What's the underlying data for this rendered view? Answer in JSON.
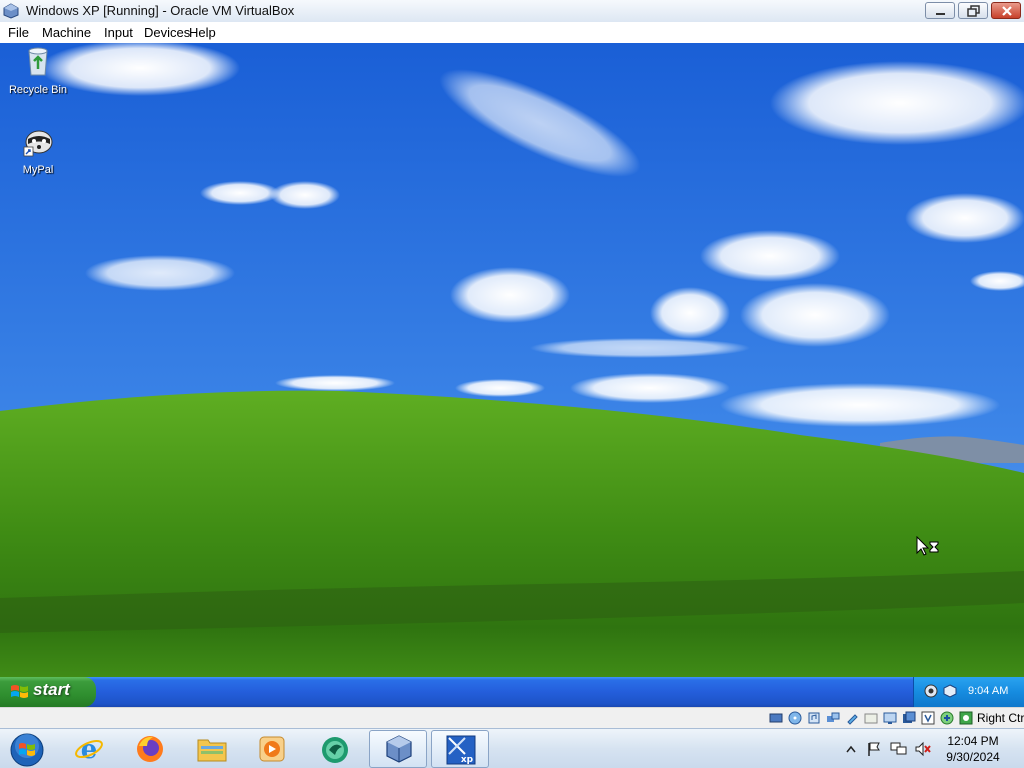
{
  "window": {
    "title": "Windows XP [Running] - Oracle VM VirtualBox",
    "icon": "virtualbox-icon",
    "controls": [
      "minimize-icon",
      "restore-icon",
      "close-icon"
    ]
  },
  "menubar": {
    "items": [
      "File",
      "Machine",
      "Input",
      "Devices",
      "Help"
    ]
  },
  "guest": {
    "desktop_icons": [
      {
        "label": "Recycle Bin",
        "icon": "recycle-bin-icon"
      },
      {
        "label": "MyPal",
        "icon": "mypal-icon"
      }
    ],
    "cursor": "busy-arrow-cursor",
    "taskbar": {
      "start_label": "start",
      "tray_icons": [
        "network-icon",
        "vbox-guest-additions-icon"
      ],
      "clock": "9:04 AM"
    }
  },
  "vbox_status": {
    "icons": [
      "hard-disk-icon",
      "optical-drive-icon",
      "audio-icon",
      "network-adapter-icon",
      "usb-icon",
      "shared-folders-icon",
      "display-icon",
      "video-capture-icon",
      "recording-icon",
      "virtualization-icon",
      "cpu-icon",
      "mouse-integration-icon",
      "keyboard-icon"
    ],
    "host_key": "Right Ctrl"
  },
  "host_taskbar": {
    "pinned": [
      "windows-start-orb-icon",
      "internet-explorer-icon",
      "firefox-icon",
      "file-explorer-icon",
      "media-player-icon",
      "app-icon",
      "virtualbox-manager-icon",
      "windows-xp-vm-icon"
    ],
    "tray_icons": [
      "show-hidden-icons-icon",
      "action-center-flag-icon",
      "network-icon",
      "volume-muted-icon"
    ],
    "time": "12:04 PM",
    "date": "9/30/2024"
  },
  "colors": {
    "xp_taskbar": "#245edb",
    "xp_start": "#3c9c3c",
    "sky": "#2f74e0",
    "hill": "#4a9a1a"
  }
}
